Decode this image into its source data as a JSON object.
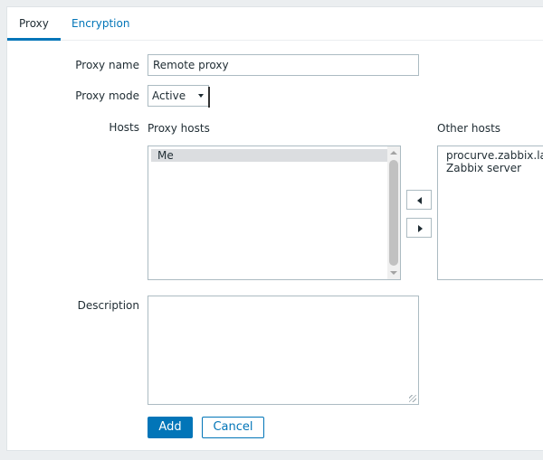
{
  "tabs": [
    {
      "label": "Proxy",
      "active": true
    },
    {
      "label": "Encryption",
      "active": false
    }
  ],
  "form": {
    "proxy_name": {
      "label": "Proxy name",
      "value": "Remote proxy"
    },
    "proxy_mode": {
      "label": "Proxy mode",
      "value": "Active"
    },
    "hosts": {
      "label": "Hosts",
      "proxy_hosts_label": "Proxy hosts",
      "proxy_hosts": [
        "Me"
      ],
      "other_hosts_label": "Other hosts",
      "other_hosts": [
        "procurve.zabbix.lan",
        "Zabbix server"
      ],
      "move_left_icon": "triangle-left-icon",
      "move_right_icon": "triangle-right-icon"
    },
    "description": {
      "label": "Description",
      "value": ""
    }
  },
  "actions": {
    "add_label": "Add",
    "cancel_label": "Cancel"
  },
  "colors": {
    "accent": "#0275b8",
    "background": "#ebeef0",
    "border": "#acbbc2",
    "selected_item": "#dbdde0"
  }
}
